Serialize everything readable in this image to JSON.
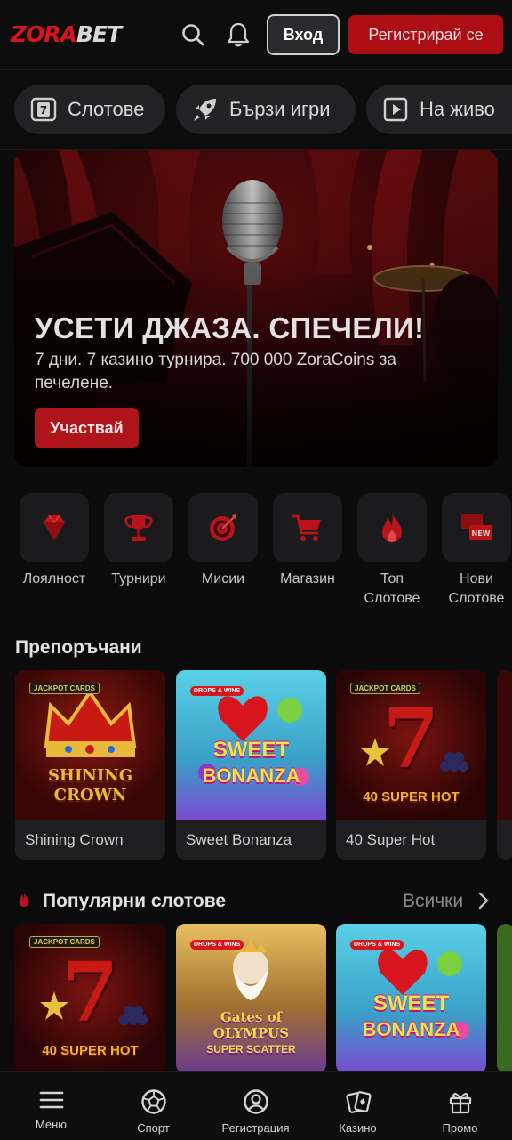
{
  "header": {
    "logo_primary": "ZORA",
    "logo_secondary": "BET",
    "login_label": "Вход",
    "register_label": "Регистрирай се",
    "icons": [
      "search-icon",
      "bell-icon"
    ]
  },
  "categories": [
    {
      "label": "Слотове",
      "icon": "slot-7-icon"
    },
    {
      "label": "Бързи игри",
      "icon": "rocket-icon"
    },
    {
      "label": "На живо",
      "icon": "play-icon"
    }
  ],
  "banner": {
    "title": "УСЕТИ ДЖАЗА. СПЕЧЕЛИ!",
    "subtitle": "7 дни. 7 казино турнира. 700 000 ZoraCoins за печелене.",
    "cta": "Участвай"
  },
  "quick_links": [
    {
      "label": "Лоялност",
      "icon": "diamond-icon"
    },
    {
      "label": "Турнири",
      "icon": "trophy-icon"
    },
    {
      "label": "Мисии",
      "icon": "target-icon"
    },
    {
      "label": "Магазин",
      "icon": "cart-icon"
    },
    {
      "label": "Топ Слотове",
      "icon": "flame-icon"
    },
    {
      "label": "Нови Слотове",
      "icon": "new-badge-icon"
    }
  ],
  "recommended": {
    "title": "Препоръчани",
    "games": [
      {
        "name": "Shining Crown",
        "art_line1": "SHINING",
        "art_line2": "CROWN",
        "badge": "JACKPOT CARDS"
      },
      {
        "name": "Sweet Bonanza",
        "art_line1": "SWEET",
        "art_line2": "BONANZA",
        "badge": "DROPS & WINS"
      },
      {
        "name": "40 Super Hot",
        "art_line1": "7",
        "art_line2": "40 SUPER HOT",
        "badge": "JACKPOT CARDS"
      }
    ]
  },
  "popular": {
    "title": "Популярни слотове",
    "see_all": "Всички",
    "games": [
      {
        "art_line1": "7",
        "art_line2": "40 SUPER HOT",
        "badge": "JACKPOT CARDS"
      },
      {
        "art_line1": "Gates of OLYMPUS",
        "art_line2": "SUPER SCATTER",
        "badge": "DROPS & WINS"
      },
      {
        "art_line1": "SWEET",
        "art_line2": "BONANZA",
        "badge": "DROPS & WINS"
      }
    ]
  },
  "bottom_nav": [
    {
      "label": "Меню",
      "icon": "menu-icon"
    },
    {
      "label": "Спорт",
      "icon": "soccer-ball-icon"
    },
    {
      "label": "Регистрация",
      "icon": "user-circle-icon"
    },
    {
      "label": "Казино",
      "icon": "cards-icon"
    },
    {
      "label": "Промо",
      "icon": "gift-icon"
    }
  ],
  "colors": {
    "brand_red": "#d8141c",
    "button_red": "#ad0e14",
    "background": "#0b0b0c"
  }
}
